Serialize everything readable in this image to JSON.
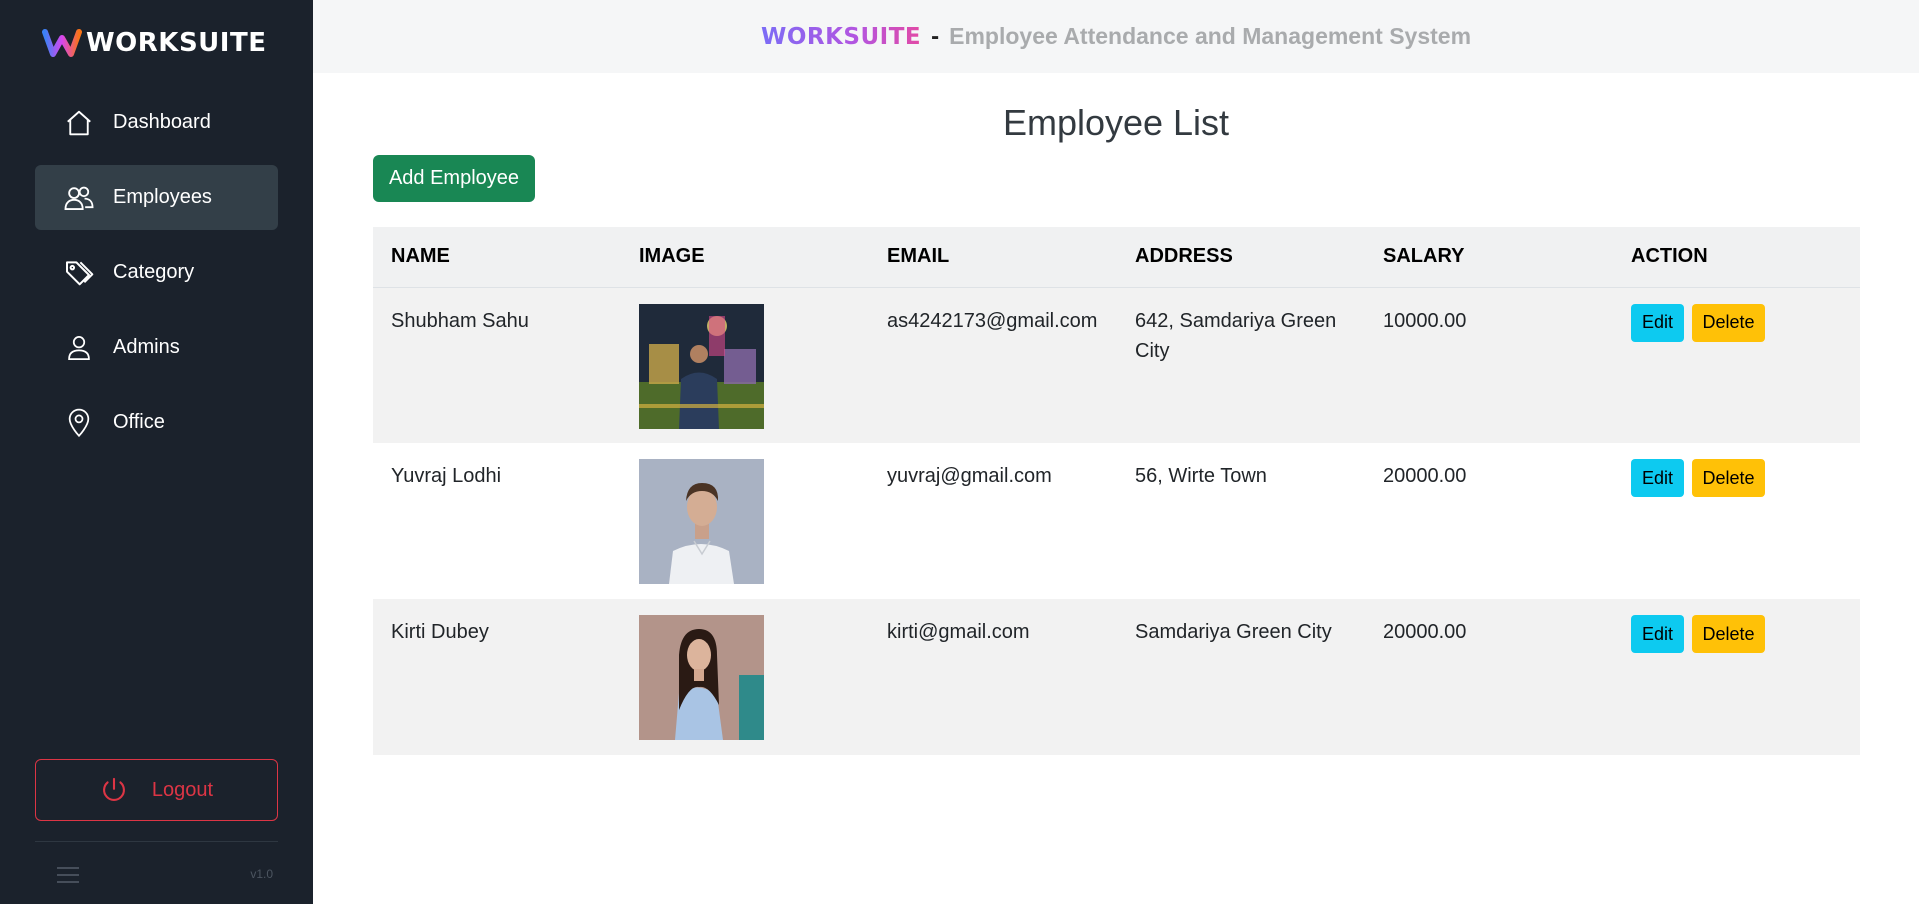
{
  "brand": {
    "name": "WORKSUITE"
  },
  "header": {
    "brand": "WORKSUITE",
    "separator": "-",
    "title": "Employee Attendance and Management System"
  },
  "sidebar": {
    "items": [
      {
        "label": "Dashboard",
        "icon": "home-icon",
        "active": false
      },
      {
        "label": "Employees",
        "icon": "users-icon",
        "active": true
      },
      {
        "label": "Category",
        "icon": "tags-icon",
        "active": false
      },
      {
        "label": "Admins",
        "icon": "person-icon",
        "active": false
      },
      {
        "label": "Office",
        "icon": "location-pin-icon",
        "active": false
      }
    ],
    "logout_label": "Logout",
    "version": "v1.0"
  },
  "main": {
    "title": "Employee List",
    "add_button": "Add Employee",
    "table": {
      "headers": [
        "NAME",
        "IMAGE",
        "EMAIL",
        "ADDRESS",
        "SALARY",
        "ACTION"
      ],
      "rows": [
        {
          "name": "Shubham Sahu",
          "email": "as4242173@gmail.com",
          "address": "642, Samdariya Green City",
          "salary": "10000.00"
        },
        {
          "name": "Yuvraj Lodhi",
          "email": "yuvraj@gmail.com",
          "address": "56, Wirte Town",
          "salary": "20000.00"
        },
        {
          "name": "Kirti Dubey",
          "email": "kirti@gmail.com",
          "address": "Samdariya Green City",
          "salary": "20000.00"
        }
      ],
      "edit_label": "Edit",
      "delete_label": "Delete"
    }
  },
  "colors": {
    "sidebar_bg": "#1b222c",
    "active_item": "#333f48",
    "add_button": "#198754",
    "edit_button": "#0dcaf0",
    "delete_button": "#ffc107",
    "logout": "#dc3545"
  }
}
